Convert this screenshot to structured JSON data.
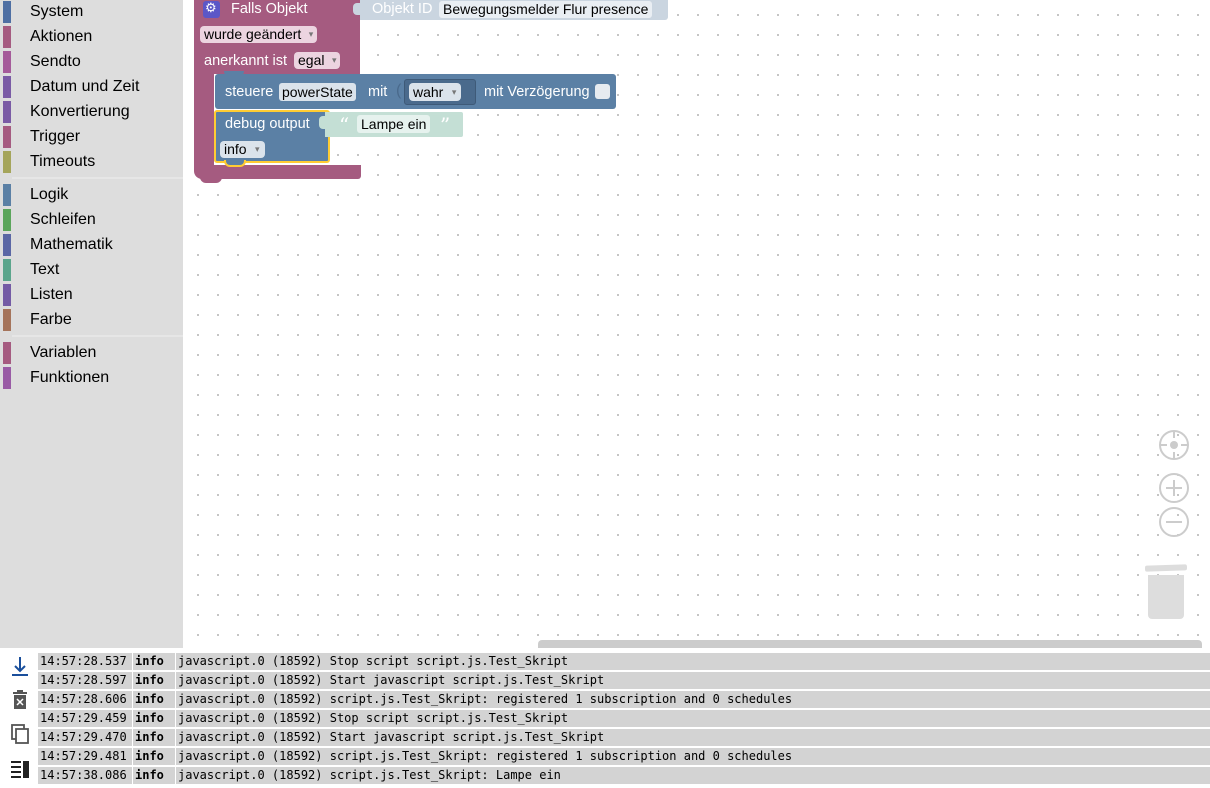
{
  "toolbox": {
    "items": [
      {
        "label": "System",
        "color": "#4e6fa3"
      },
      {
        "label": "Aktionen",
        "color": "#a55b80"
      },
      {
        "label": "Sendto",
        "color": "#a55b9a"
      },
      {
        "label": "Datum und Zeit",
        "color": "#7a5ba5"
      },
      {
        "label": "Konvertierung",
        "color": "#7a5ba5"
      },
      {
        "label": "Trigger",
        "color": "#a55b80"
      },
      {
        "label": "Timeouts",
        "color": "#a5a55b"
      },
      {
        "label": "Logik",
        "color": "#5b80a5"
      },
      {
        "label": "Schleifen",
        "color": "#5ba55b"
      },
      {
        "label": "Mathematik",
        "color": "#5b67a5"
      },
      {
        "label": "Text",
        "color": "#5ba58c"
      },
      {
        "label": "Listen",
        "color": "#745ba5"
      },
      {
        "label": "Farbe",
        "color": "#a5745b"
      },
      {
        "label": "Variablen",
        "color": "#a55b80"
      },
      {
        "label": "Funktionen",
        "color": "#995ba5"
      }
    ]
  },
  "blocks": {
    "trigger": {
      "title": "Falls Objekt",
      "object_id_label": "Objekt ID",
      "object_id_value": "Bewegungsmelder Flur presence",
      "condition": "wurde geändert",
      "ack_label": "anerkannt ist",
      "ack_value": "egal"
    },
    "control": {
      "label": "steuere",
      "state": "powerState",
      "with_label": "mit",
      "value": "wahr",
      "delay_label": "mit Verzögerung"
    },
    "debug": {
      "label": "debug output",
      "text": "Lampe ein",
      "level": "info",
      "open_quote": "“",
      "close_quote": "”"
    }
  },
  "log": {
    "rows": [
      {
        "time": "14:57:28.537",
        "level": "info",
        "message": "javascript.0 (18592) Stop script script.js.Test_Skript"
      },
      {
        "time": "14:57:28.597",
        "level": "info",
        "message": "javascript.0 (18592) Start javascript script.js.Test_Skript"
      },
      {
        "time": "14:57:28.606",
        "level": "info",
        "message": "javascript.0 (18592) script.js.Test_Skript: registered 1 subscription and 0 schedules"
      },
      {
        "time": "14:57:29.459",
        "level": "info",
        "message": "javascript.0 (18592) Stop script script.js.Test_Skript"
      },
      {
        "time": "14:57:29.470",
        "level": "info",
        "message": "javascript.0 (18592) Start javascript script.js.Test_Skript"
      },
      {
        "time": "14:57:29.481",
        "level": "info",
        "message": "javascript.0 (18592) script.js.Test_Skript: registered 1 subscription and 0 schedules"
      },
      {
        "time": "14:57:38.086",
        "level": "info",
        "message": "javascript.0 (18592) script.js.Test_Skript: Lampe ein"
      }
    ]
  }
}
